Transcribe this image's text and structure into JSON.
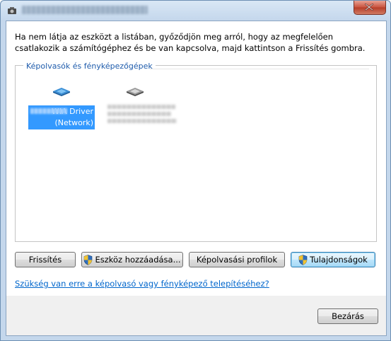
{
  "window": {
    "title_text": ""
  },
  "instruction": "Ha nem látja az eszközt a listában, győződjön meg arról, hogy az megfelelően csatlakozik a számítógéphez és be van kapcsolva, majd kattintson a Frissítés gombra.",
  "group": {
    "label": "Képolvasók és fényképezőgépek",
    "devices": [
      {
        "label": "WIA Driver (Network)",
        "selected": true,
        "icon": "scanner-icon"
      },
      {
        "label": "",
        "selected": false,
        "icon": "scanner-icon"
      }
    ]
  },
  "buttons": {
    "refresh": "Frissítés",
    "add_device": "Eszköz hozzáadása...",
    "scan_profiles": "Képolvasási profilok",
    "properties": "Tulajdonságok",
    "close": "Bezárás"
  },
  "link": "Szükség van erre a képolvasó vagy fényképező telepítéséhez?",
  "colors": {
    "selection": "#3399ff",
    "group_label": "#1e5bab",
    "link": "#0066cc"
  }
}
